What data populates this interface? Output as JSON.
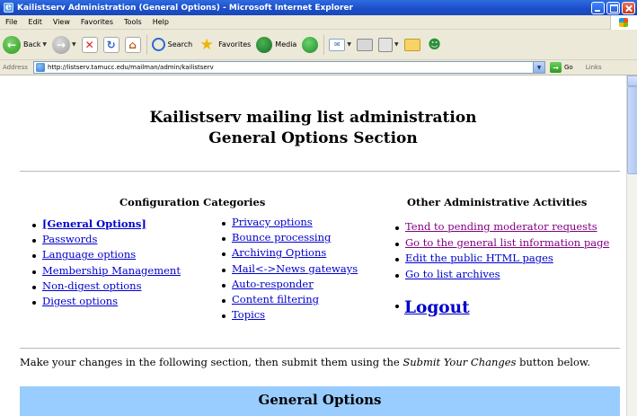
{
  "window": {
    "title": "Kailistserv Administration (General Options) - Microsoft Internet Explorer"
  },
  "menubar": {
    "items": [
      "File",
      "Edit",
      "View",
      "Favorites",
      "Tools",
      "Help"
    ]
  },
  "toolbar": {
    "back": "Back",
    "search": "Search",
    "favorites": "Favorites",
    "media": "Media"
  },
  "addressbar": {
    "label": "Address",
    "url": "http://listserv.tamucc.edu/mailman/admin/kailistserv",
    "go": "Go",
    "links": "Links"
  },
  "page": {
    "heading_line1": "Kailistserv mailing list administration",
    "heading_line2": "General Options Section",
    "config_title": "Configuration Categories",
    "other_title": "Other Administrative Activities",
    "config_col1": [
      "[General Options]",
      "Passwords",
      "Language options",
      "Membership Management",
      "Non-digest options",
      "Digest options"
    ],
    "config_col2": [
      "Privacy options",
      "Bounce processing",
      "Archiving Options",
      "Mail<->News gateways",
      "Auto-responder",
      "Content filtering",
      "Topics"
    ],
    "other_links": [
      "Tend to pending moderator requests",
      "Go to the general list information page",
      "Edit the public HTML pages",
      "Go to list archives"
    ],
    "logout": "Logout",
    "instructions_before": "Make your changes in the following section, then submit them using the ",
    "instructions_em": "Submit Your Changes",
    "instructions_after": " button below.",
    "section_title": "General Options"
  },
  "colors": {
    "link": "#0000cc",
    "visited_link": "#800080",
    "section_band": "#99ccff",
    "titlebar": "#1b4fc9"
  }
}
